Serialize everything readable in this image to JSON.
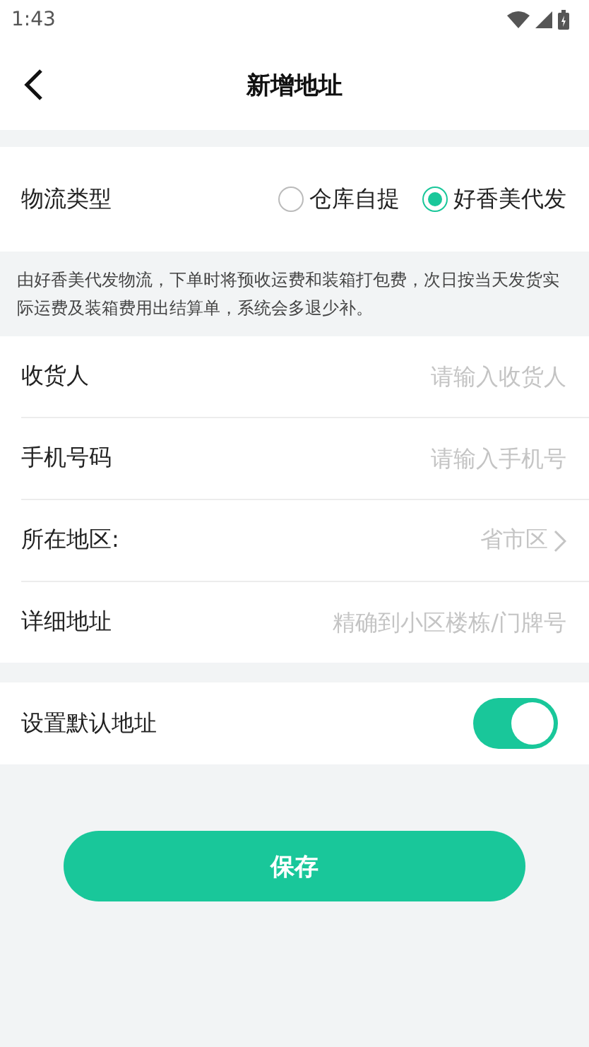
{
  "status_bar": {
    "time": "1:43"
  },
  "header": {
    "title": "新增地址"
  },
  "logistics": {
    "label": "物流类型",
    "options": [
      {
        "label": "仓库自提",
        "selected": false
      },
      {
        "label": "好香美代发",
        "selected": true
      }
    ]
  },
  "notice": "由好香美代发物流，下单时将预收运费和装箱打包费，次日按当天发货实际运费及装箱费用出结算单，系统会多退少补。",
  "fields": [
    {
      "kind": "input",
      "label": "收货人",
      "placeholder": "请输入收货人"
    },
    {
      "kind": "input",
      "label": "手机号码",
      "placeholder": "请输入手机号"
    },
    {
      "kind": "picker",
      "label": "所在地区:",
      "placeholder": "省市区"
    },
    {
      "kind": "input",
      "label": "详细地址",
      "placeholder": "精确到小区楼栋/门牌号"
    }
  ],
  "default_address": {
    "label": "设置默认地址",
    "on": true
  },
  "save_button": "保存"
}
